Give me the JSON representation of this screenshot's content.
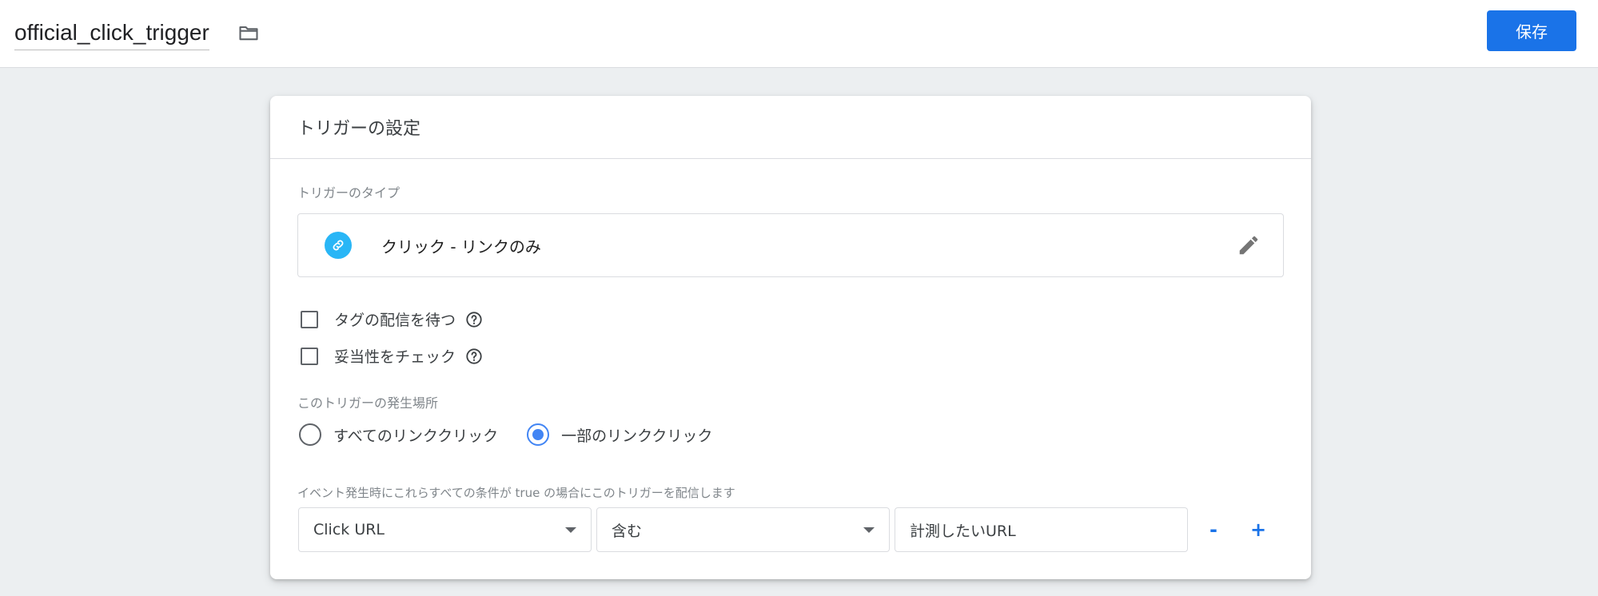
{
  "header": {
    "trigger_name": "official_click_trigger",
    "folder_icon": "folder-icon",
    "save_label": "保存"
  },
  "card": {
    "title": "トリガーの設定",
    "type_section_label": "トリガーのタイプ",
    "trigger_type": {
      "label": "クリック - リンクのみ",
      "icon": "link-icon",
      "icon_color": "#29b6f6",
      "edit_icon": "pencil-icon"
    },
    "options": [
      {
        "label": "タグの配信を待つ",
        "checked": false
      },
      {
        "label": "妥当性をチェック",
        "checked": false
      }
    ],
    "fire_on_label": "このトリガーの発生場所",
    "fire_on_options": [
      {
        "label": "すべてのリンククリック",
        "selected": false
      },
      {
        "label": "一部のリンククリック",
        "selected": true
      }
    ],
    "condition_label": "イベント発生時にこれらすべての条件が true の場合にこのトリガーを配信します",
    "condition": {
      "variable": "Click URL",
      "operator": "含む",
      "value": "計測したいURL"
    },
    "remove_label": "-",
    "add_label": "+"
  },
  "colors": {
    "accent": "#1a73e8",
    "radio_selected": "#4285f4",
    "background": "#eceff1"
  }
}
